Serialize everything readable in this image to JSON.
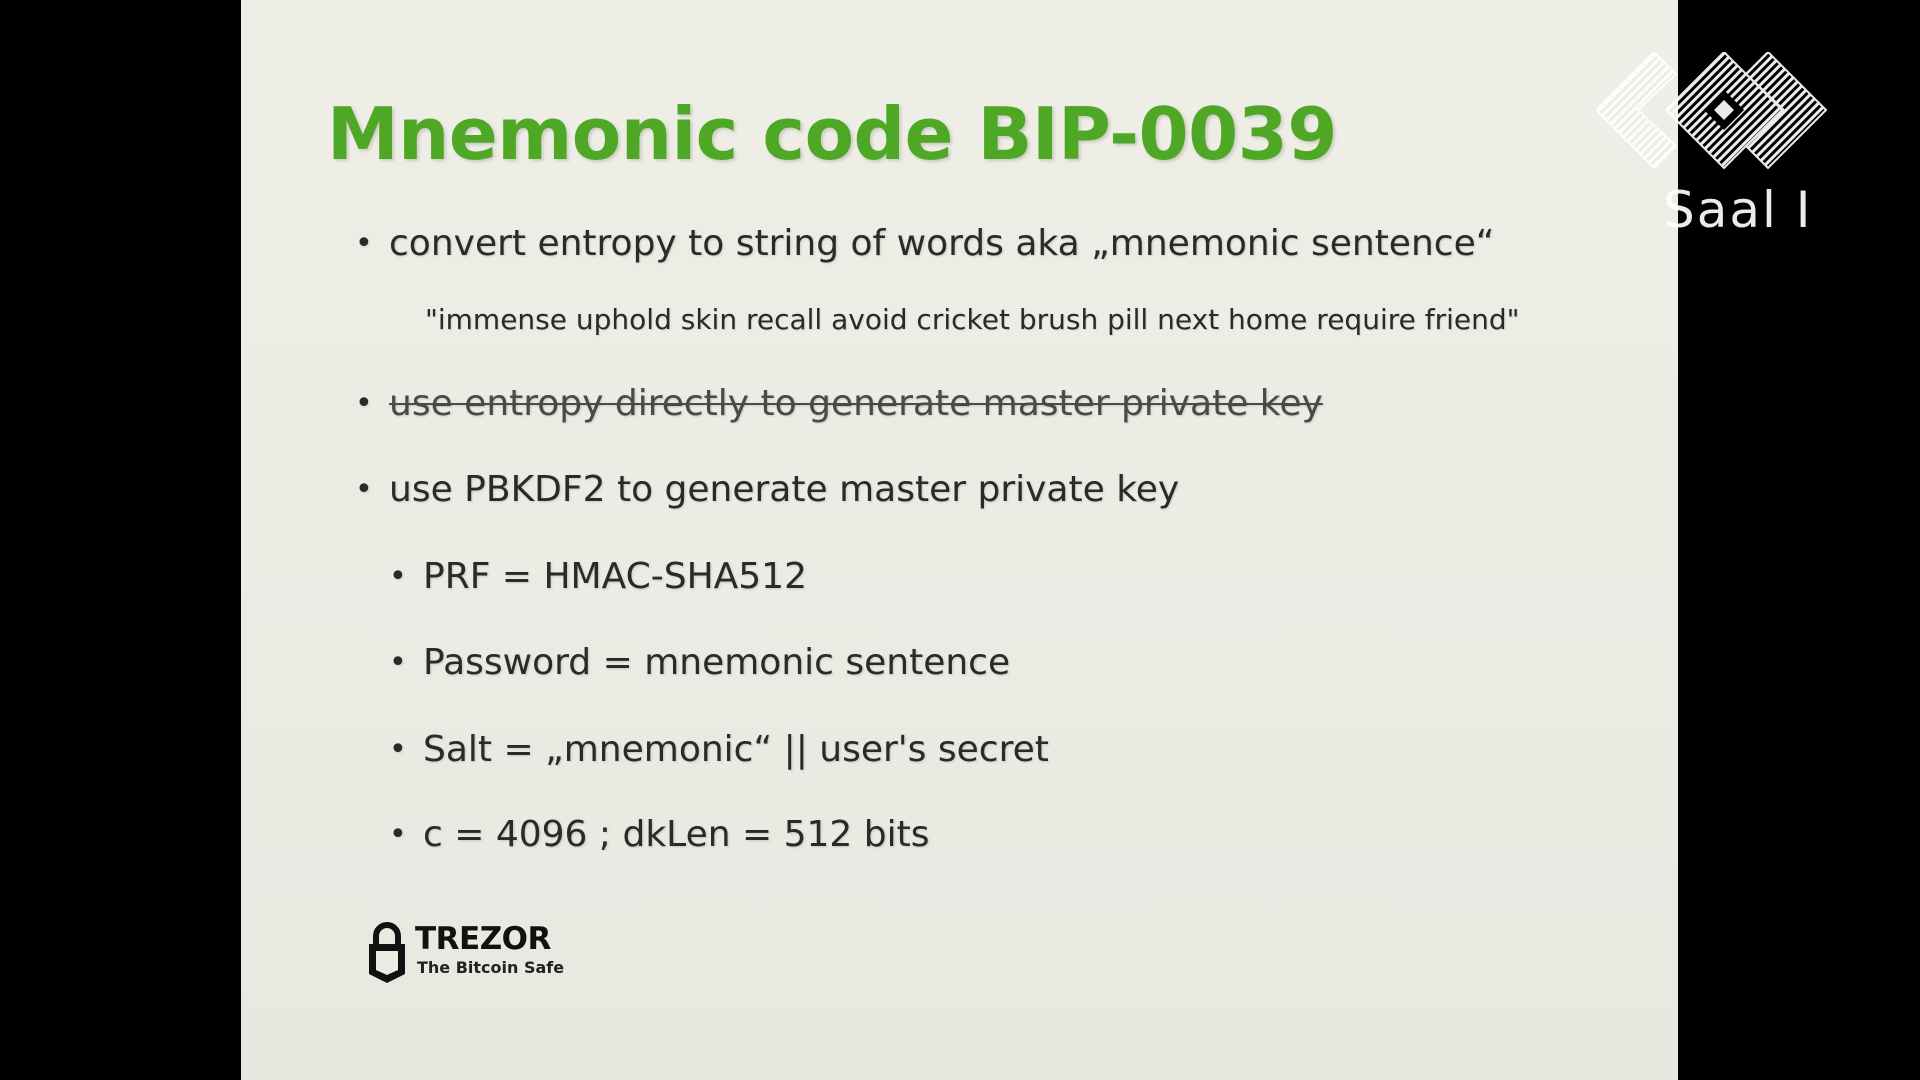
{
  "slide": {
    "title": "Mnemonic code BIP-0039",
    "bullets": [
      "convert entropy to string of words aka „mnemonic sentence“",
      "use entropy directly to generate master private key",
      "use PBKDF2 to generate master private key"
    ],
    "example": "\"immense uphold skin recall avoid cricket brush pill next home require friend\"",
    "sub_bullets": [
      "PRF = HMAC-SHA512",
      "Password = mnemonic sentence",
      "Salt = „mnemonic“ || user's secret",
      "c = 4096 ; dkLen = 512 bits"
    ],
    "bullet_glyph": "•",
    "title_color": "#4ea825"
  },
  "trezor": {
    "name": "TREZOR",
    "tagline": "The Bitcoin Safe"
  },
  "overlay": {
    "hall_label": "Saal I"
  }
}
